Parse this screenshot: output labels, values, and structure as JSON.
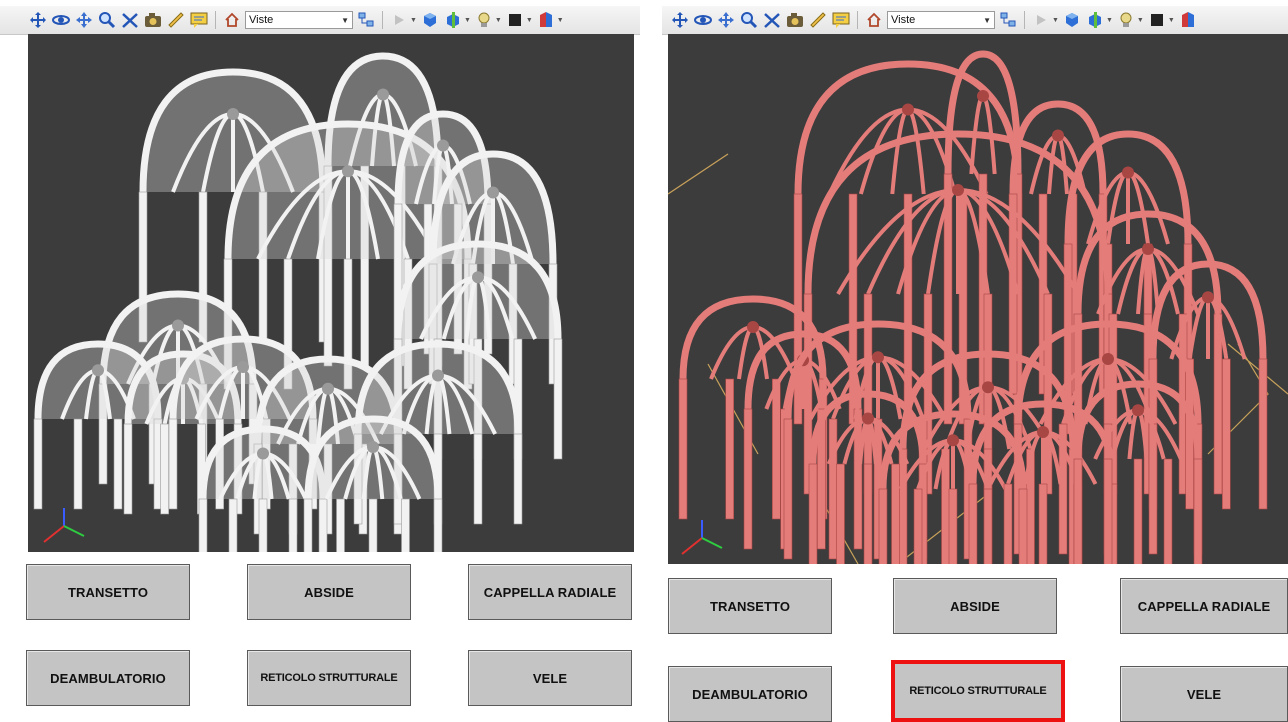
{
  "toolbar": {
    "views_label": "Viste",
    "icons": [
      "pan-icon",
      "orbit-icon",
      "fly-icon",
      "zoom-icon",
      "measure-angle-icon",
      "camera-icon",
      "ruler-icon",
      "comment-icon",
      "home-icon",
      "viewpoints-icon",
      "play-icon",
      "cube-icon",
      "section-icon",
      "light-icon",
      "render-style-icon",
      "appearance-icon"
    ]
  },
  "left_panel": {
    "buttons": {
      "transetto": "TRANSETTO",
      "abside": "ABSIDE",
      "cappella": "CAPPELLA RADIALE",
      "deambulatorio": "DEAMBULATORIO",
      "reticolo": "RETICOLO STRUTTURALE",
      "vele": "VELE"
    }
  },
  "right_panel": {
    "active_button": "reticolo",
    "buttons": {
      "transetto": "TRANSETTO",
      "abside": "ABSIDE",
      "cappella": "CAPPELLA RADIALE",
      "deambulatorio": "DEAMBULATORIO",
      "reticolo": "RETICOLO STRUTTURALE",
      "vele": "VELE"
    }
  },
  "colors": {
    "viewport_bg": "#3c3c3c",
    "model_left": "#e8e8e8",
    "model_right": "#e07a78",
    "active_border": "#ee1111",
    "button_bg": "#c4c4c4"
  }
}
